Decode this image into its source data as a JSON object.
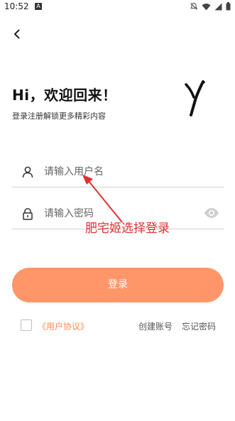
{
  "status_bar": {
    "time": "10:52",
    "notification_badge": "A"
  },
  "greeting": {
    "title": "Hi，欢迎回来！",
    "subtitle": "登录注册解锁更多精彩内容"
  },
  "form": {
    "username_placeholder": "请输入用户名",
    "password_placeholder": "请输入密码"
  },
  "login_button": "登录",
  "footer": {
    "agreement_link": "《用户协议》",
    "register_link": "创建账号",
    "forgot_link": "忘记密码"
  },
  "overlay": {
    "annotation_text": "肥宅姬选择登录",
    "annotation_color": "#e03131"
  },
  "theme": {
    "accent": "#ff966a"
  }
}
